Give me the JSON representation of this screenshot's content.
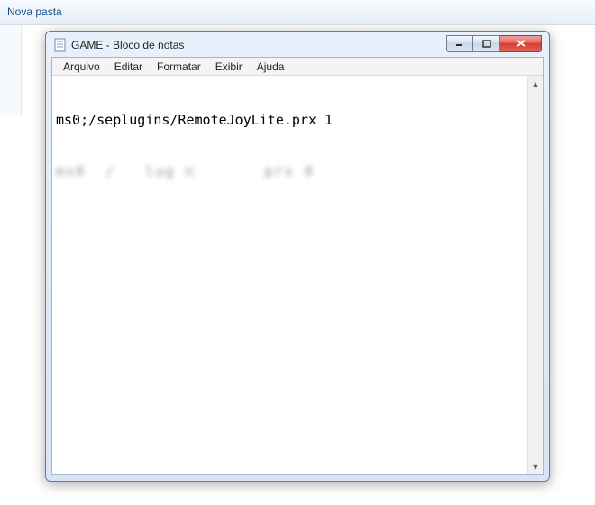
{
  "explorer": {
    "breadcrumb": "Nova pasta"
  },
  "window": {
    "title": "GAME - Bloco de notas"
  },
  "menu": {
    "file": "Arquivo",
    "edit": "Editar",
    "format": "Formatar",
    "view": "Exibir",
    "help": "Ajuda"
  },
  "editor": {
    "line1": "ms0;/seplugins/RemoteJoyLite.prx 1",
    "line2_obscured": "ms0  /   lug n       prx 0"
  },
  "scroll": {
    "up_glyph": "▲",
    "down_glyph": "▼"
  }
}
